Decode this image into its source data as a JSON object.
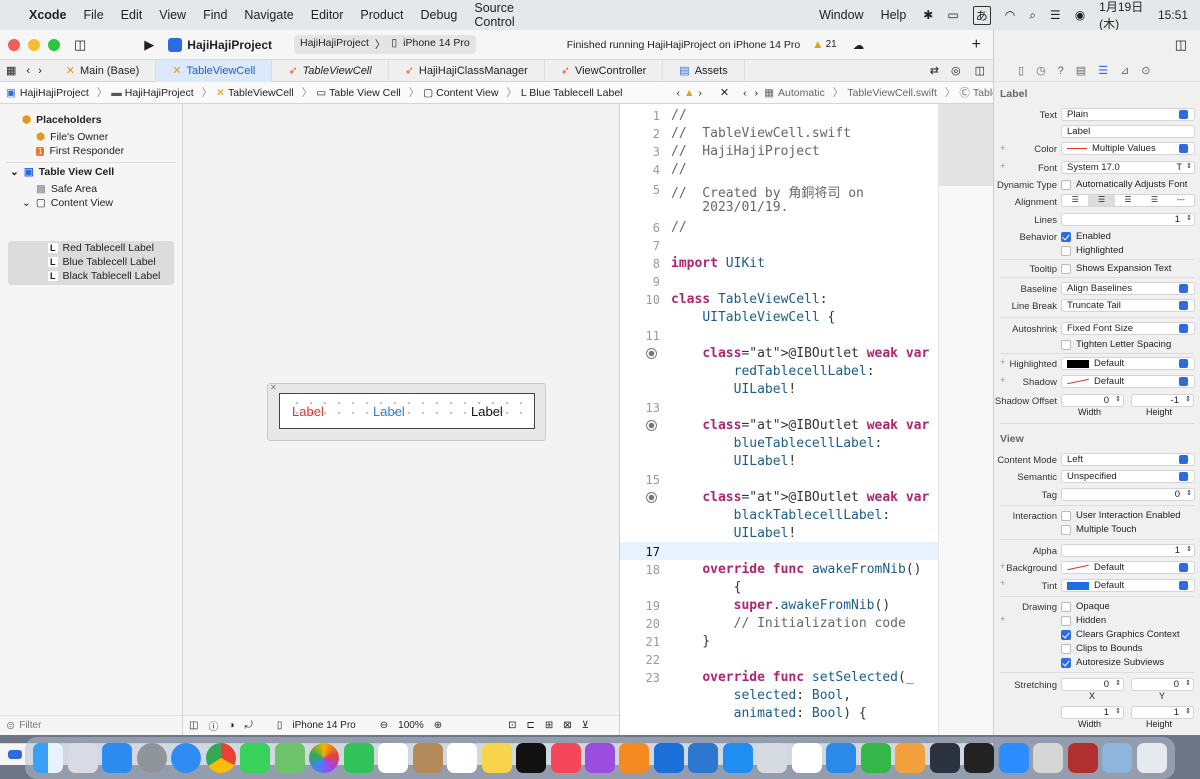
{
  "menubar": {
    "app": "Xcode",
    "items": [
      "File",
      "Edit",
      "View",
      "Find",
      "Navigate",
      "Editor",
      "Product",
      "Debug",
      "Source Control"
    ],
    "window": "Window",
    "help": "Help",
    "input_method": "あ",
    "date": "1月19日(木)",
    "time": "15:51"
  },
  "toolbar": {
    "project": "HajiHajiProject",
    "scheme": "HajiHajiProject",
    "device": "iPhone 14 Pro",
    "status": "Finished running HajiHajiProject on iPhone 14 Pro",
    "warnings": "21"
  },
  "tabs": [
    "Main (Base)",
    "TableViewCell",
    "TableViewCell",
    "HajiHajiClassManager",
    "ViewController",
    "Assets"
  ],
  "breadcrumb": [
    "HajiHajiProject",
    "HajiHajiProject",
    "TableViewCell",
    "Table View Cell",
    "Content View",
    "L  Blue Tablecell Label"
  ],
  "editor_crumb": [
    "Automatic",
    "TableViewCell.swift",
    "TableViewCell"
  ],
  "outline": {
    "placeholders": "Placeholders",
    "files_owner": "File's Owner",
    "first_responder": "First Responder",
    "cell": "Table View Cell",
    "safe_area": "Safe Area",
    "content_view": "Content View",
    "labels": [
      "Red Tablecell Label",
      "Blue Tablecell Label",
      "Black Tablecell Label"
    ]
  },
  "canvas": {
    "labels": [
      "Label",
      "Label",
      "Label"
    ],
    "device": "iPhone 14 Pro",
    "zoom": "100%",
    "filter_placeholder": "Filter"
  },
  "code": {
    "line_numbers": [
      "1",
      "2",
      "3",
      "4",
      "5",
      "",
      "6",
      "7",
      "8",
      "9",
      "10",
      "",
      "11",
      "",
      "",
      "",
      "13",
      "",
      "",
      "",
      "15",
      "",
      "",
      "",
      "17",
      "18",
      "",
      "19",
      "20",
      "21",
      "22",
      "23",
      "",
      ""
    ],
    "lines": [
      "//",
      "//  TableViewCell.swift",
      "//  HajiHajiProject",
      "//",
      "//  Created by 角銅将司 on",
      "    2023/01/19.",
      "//",
      "",
      "import UIKit",
      "",
      "class TableViewCell:",
      "    UITableViewCell {",
      "",
      "    @IBOutlet weak var",
      "        redTablecellLabel:",
      "        UILabel!",
      "",
      "    @IBOutlet weak var",
      "        blueTablecellLabel:",
      "        UILabel!",
      "",
      "    @IBOutlet weak var",
      "        blackTablecellLabel:",
      "        UILabel!",
      "",
      "    override func awakeFromNib()",
      "        {",
      "        super.awakeFromNib()",
      "        // Initialization code",
      "    }",
      "",
      "    override func setSelected(_",
      "        selected: Bool,",
      "        animated: Bool) {"
    ]
  },
  "inspector": {
    "label_section": "Label",
    "text_label": "Text",
    "text_value": "Plain",
    "text_content": "Label",
    "color_label": "Color",
    "color_value": "Multiple Values",
    "font_label": "Font",
    "font_value": "System 17.0",
    "dynamic_type_label": "Dynamic Type",
    "dynamic_type_value": "Automatically Adjusts Font",
    "alignment_label": "Alignment",
    "lines_label": "Lines",
    "lines_value": "1",
    "behavior_label": "Behavior",
    "enabled": "Enabled",
    "highlighted": "Highlighted",
    "tooltip_label": "Tooltip",
    "tooltip_value": "Shows Expansion Text",
    "baseline_label": "Baseline",
    "baseline_value": "Align Baselines",
    "linebreak_label": "Line Break",
    "linebreak_value": "Truncate Tail",
    "autoshrink_label": "Autoshrink",
    "autoshrink_value": "Fixed Font Size",
    "tighten": "Tighten Letter Spacing",
    "highlighted_label": "Highlighted",
    "highlighted_value": "Default",
    "shadow_label": "Shadow",
    "shadow_value": "Default",
    "shadow_offset_label": "Shadow Offset",
    "shadow_w": "0",
    "shadow_h": "-1",
    "width": "Width",
    "height": "Height",
    "view_section": "View",
    "content_mode_label": "Content Mode",
    "content_mode_value": "Left",
    "semantic_label": "Semantic",
    "semantic_value": "Unspecified",
    "tag_label": "Tag",
    "tag_value": "0",
    "interaction_label": "Interaction",
    "user_interaction": "User Interaction Enabled",
    "multiple_touch": "Multiple Touch",
    "alpha_label": "Alpha",
    "alpha_value": "1",
    "background_label": "Background",
    "background_value": "Default",
    "tint_label": "Tint",
    "tint_value": "Default",
    "drawing_label": "Drawing",
    "opaque": "Opaque",
    "hidden": "Hidden",
    "clears": "Clears Graphics Context",
    "clips": "Clips to Bounds",
    "autoresize": "Autoresize Subviews",
    "stretching_label": "Stretching",
    "stretch_x": "0",
    "stretch_y": "0",
    "stretch_w": "1",
    "stretch_h": "1",
    "x": "X",
    "y": "Y"
  },
  "colors": {
    "accent": "#2f6be0",
    "red_label": "#e0332a",
    "blue_label": "#2f7fd8",
    "keyword": "#b0246f"
  }
}
